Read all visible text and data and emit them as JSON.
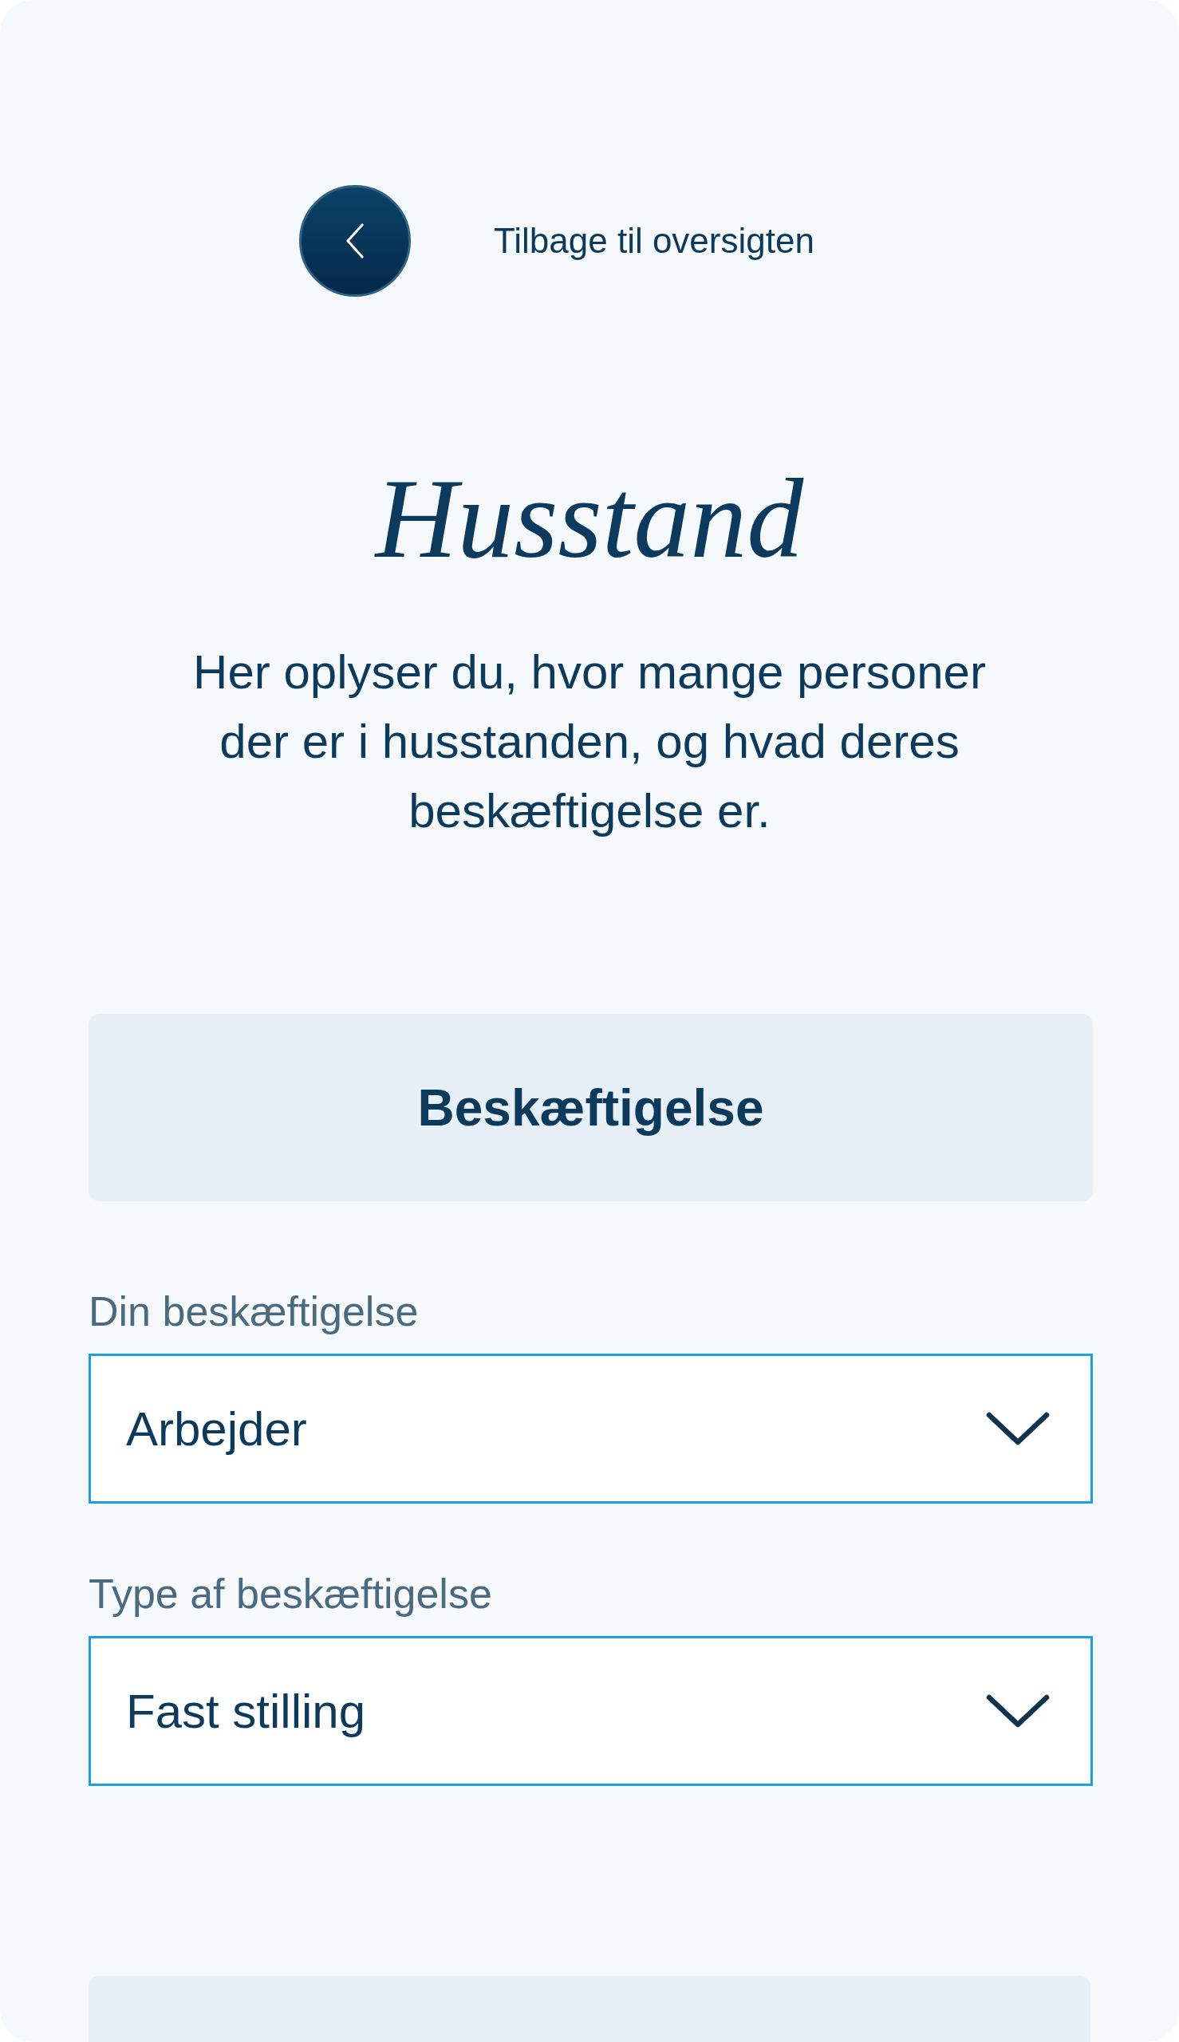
{
  "back": {
    "label": "Tilbage til oversigten"
  },
  "header": {
    "title": "Husstand",
    "intro": "Her oplyser du, hvor mange personer der er i husstanden, og hvad deres beskæftigelse er."
  },
  "sections": [
    {
      "heading": "Beskæftigelse",
      "fields": [
        {
          "kind": "select",
          "label": "Din beskæftigelse",
          "value": "Arbejder"
        },
        {
          "kind": "select",
          "label": "Type af beskæftigelse",
          "value": "Fast stilling"
        }
      ]
    }
  ]
}
